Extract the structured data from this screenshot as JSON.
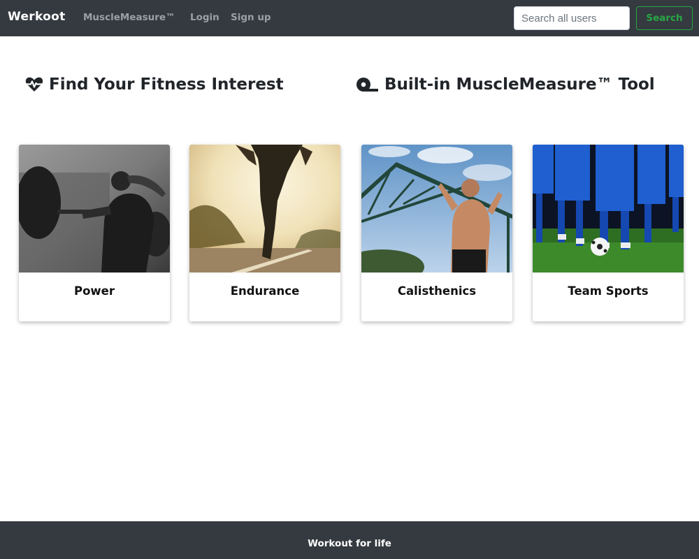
{
  "navbar": {
    "brand": "Werkoot",
    "links": [
      "MuscleMeasure™",
      "Login",
      "Sign up"
    ],
    "search_placeholder": "Search all users",
    "search_button": "Search"
  },
  "headings": {
    "fitness": {
      "text": "Find Your Fitness Interest",
      "icon": "heartbeat-icon"
    },
    "tool": {
      "text": "Built-in MuscleMeasure™ Tool",
      "icon": "tape-measure-icon"
    }
  },
  "cards": [
    {
      "title": "Power",
      "image": "barbell-lifter-photo"
    },
    {
      "title": "Endurance",
      "image": "runner-photo"
    },
    {
      "title": "Calisthenics",
      "image": "pull-up-photo"
    },
    {
      "title": "Team Sports",
      "image": "soccer-team-photo"
    }
  ],
  "footer": {
    "text": "Workout for life"
  },
  "colors": {
    "navbar_bg": "#343a40",
    "accent_green": "#28a745",
    "link_grey": "#9aa0a6"
  }
}
